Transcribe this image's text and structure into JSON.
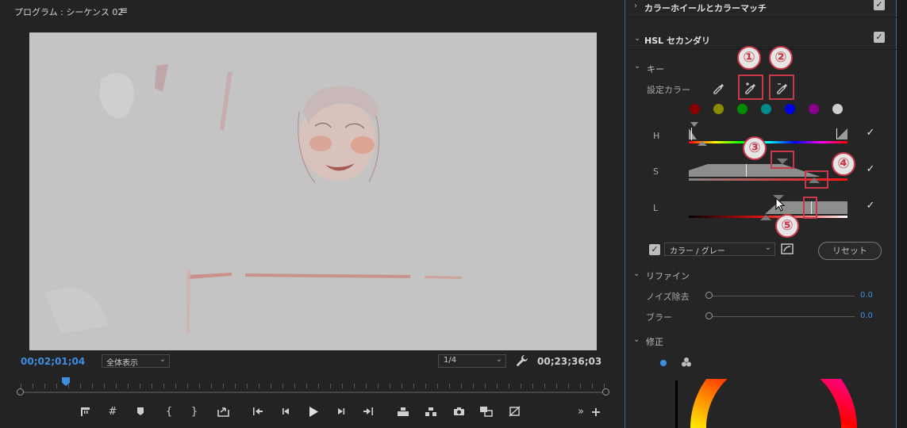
{
  "program": {
    "title": "プログラム : シーケンス 02",
    "menu_glyph": "≡",
    "timecode_current": "00;02;01;04",
    "zoom": "全体表示",
    "resolution": "1/4",
    "timecode_duration": "00;23;36;03"
  },
  "lumetri": {
    "color_wheel_section": "カラーホイールとカラーマッチ",
    "hsl_section": "HSL セカンダリ",
    "key_label": "キー",
    "set_color_label": "設定カラー",
    "swatches": [
      "#8b0000",
      "#8b8b00",
      "#008b00",
      "#008b8b",
      "#0000e6",
      "#8b008b",
      "#cccccc"
    ],
    "channel_h": "H",
    "channel_s": "S",
    "channel_l": "L",
    "display_mode": "カラー / グレー",
    "reset": "リセット",
    "refine_label": "リファイン",
    "denoise_label": "ノイズ除去",
    "denoise_value": "0.0",
    "blur_label": "ブラー",
    "blur_value": "0.0",
    "correction_label": "修正"
  },
  "annotations": [
    "①",
    "②",
    "③",
    "④",
    "⑤"
  ],
  "colors": {
    "accent_blue": "#3e8ee0",
    "highlight_red": "#c8384a",
    "panel_border": "#3b6ea8"
  }
}
